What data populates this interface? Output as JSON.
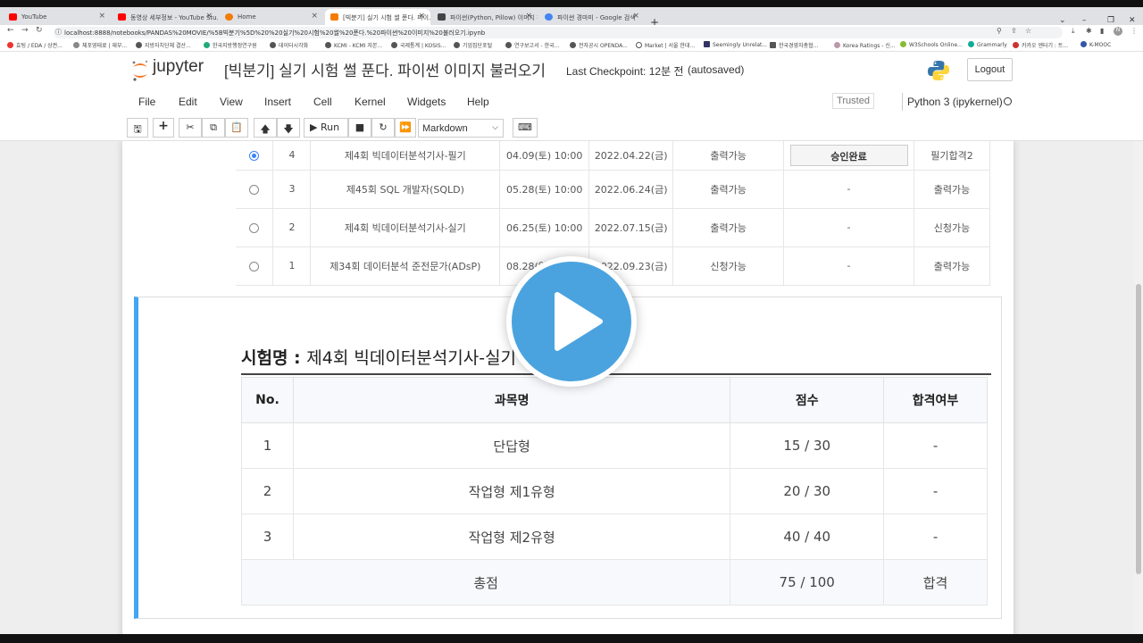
{
  "browser": {
    "tabs": [
      {
        "label": "YouTube",
        "color": "#ff0000"
      },
      {
        "label": "동영상 세부정보 - YouTube Stu...",
        "color": "#ff0000"
      },
      {
        "label": "Home",
        "color": "#f57c00"
      },
      {
        "label": "[빅분기] 실기 시험 썰 푼다. 파이...",
        "color": "#f57c00"
      },
      {
        "label": "파이썬(Python, Pillow) 이미지 파...",
        "color": "#444444"
      },
      {
        "label": "파이썬 경마미 - Google 검색",
        "color": "#4285f4"
      }
    ],
    "url": "localhost:8888/notebooks/PANDAS%20MOVIE/%5B빅분기%5D%20%20실기%20시험%20썰%20푼다.%20파이썬%20이미지%20불러오기.ipynb",
    "bookmarks": [
      "효팅 / EDA / 상권...",
      "체포영태료 | 재부...",
      "지방자치단체 결산...",
      "한국지방행정연구원",
      "데이터시각화",
      "KCMI - KCMI 자본...",
      "국제통계 | KOSIS...",
      "기업집단포털",
      "연구보고서 - 한국...",
      "전자공시 OPENDA...",
      "Market | 서울 한대...",
      "Seemingly Unrelat...",
      "한국경영자총협...",
      "Korea Ratings - 신...",
      "W3Schools Online...",
      "Grammarly",
      "카카오 엔터기 : 트...",
      "K-MOOC"
    ]
  },
  "jupyter": {
    "logo_text": "jupyter",
    "notebook_title": "[빅분기] 실기 시험 썰 푼다. 파이썬 이미지 불러오기",
    "checkpoint": "Last Checkpoint: 12분 전",
    "autosaved": "(autosaved)",
    "logout": "Logout",
    "menu": [
      "File",
      "Edit",
      "View",
      "Insert",
      "Cell",
      "Kernel",
      "Widgets",
      "Help"
    ],
    "trusted": "Trusted",
    "kernel": "Python 3 (ipykernel)",
    "toolbar": {
      "run": "Run",
      "cell_type": "Markdown"
    }
  },
  "exam_list": {
    "rows": [
      {
        "selected": true,
        "no": "4",
        "name": "제4회 빅데이터분석기사-필기",
        "date": "04.09(토) 10:00",
        "result_date": "2022.04.22(금)",
        "status": "출력가능",
        "action": "승인완료",
        "result": "필기합격2"
      },
      {
        "selected": false,
        "no": "3",
        "name": "제45회 SQL 개발자(SQLD)",
        "date": "05.28(토) 10:00",
        "result_date": "2022.06.24(금)",
        "status": "출력가능",
        "action": "-",
        "result": "출력가능"
      },
      {
        "selected": false,
        "no": "2",
        "name": "제4회 빅데이터분석기사-실기",
        "date": "06.25(토) 10:00",
        "result_date": "2022.07.15(금)",
        "status": "출력가능",
        "action": "-",
        "result": "신청가능"
      },
      {
        "selected": false,
        "no": "1",
        "name": "제34회 데이터분석 준전문가(ADsP)",
        "date": "08.28(일) 10:00",
        "result_date": "2022.09.23(금)",
        "status": "신청가능",
        "action": "-",
        "result": "출력가능"
      }
    ]
  },
  "score": {
    "label": "시험명 : ",
    "exam_name": "제4회 빅데이터분석기사-실기",
    "headers": [
      "No.",
      "과목명",
      "점수",
      "합격여부"
    ],
    "rows": [
      {
        "no": "1",
        "subject": "단답형",
        "score": "15 / 30",
        "pass": "-"
      },
      {
        "no": "2",
        "subject": "작업형 제1유형",
        "score": "20 / 30",
        "pass": "-"
      },
      {
        "no": "3",
        "subject": "작업형 제2유형",
        "score": "40 / 40",
        "pass": "-"
      }
    ],
    "total": {
      "label": "총점",
      "score": "75 / 100",
      "pass": "합격"
    }
  },
  "colors": {
    "accent": "#42a5f5",
    "play": "#4aa3df",
    "jupyter_orange": "#f37626"
  }
}
